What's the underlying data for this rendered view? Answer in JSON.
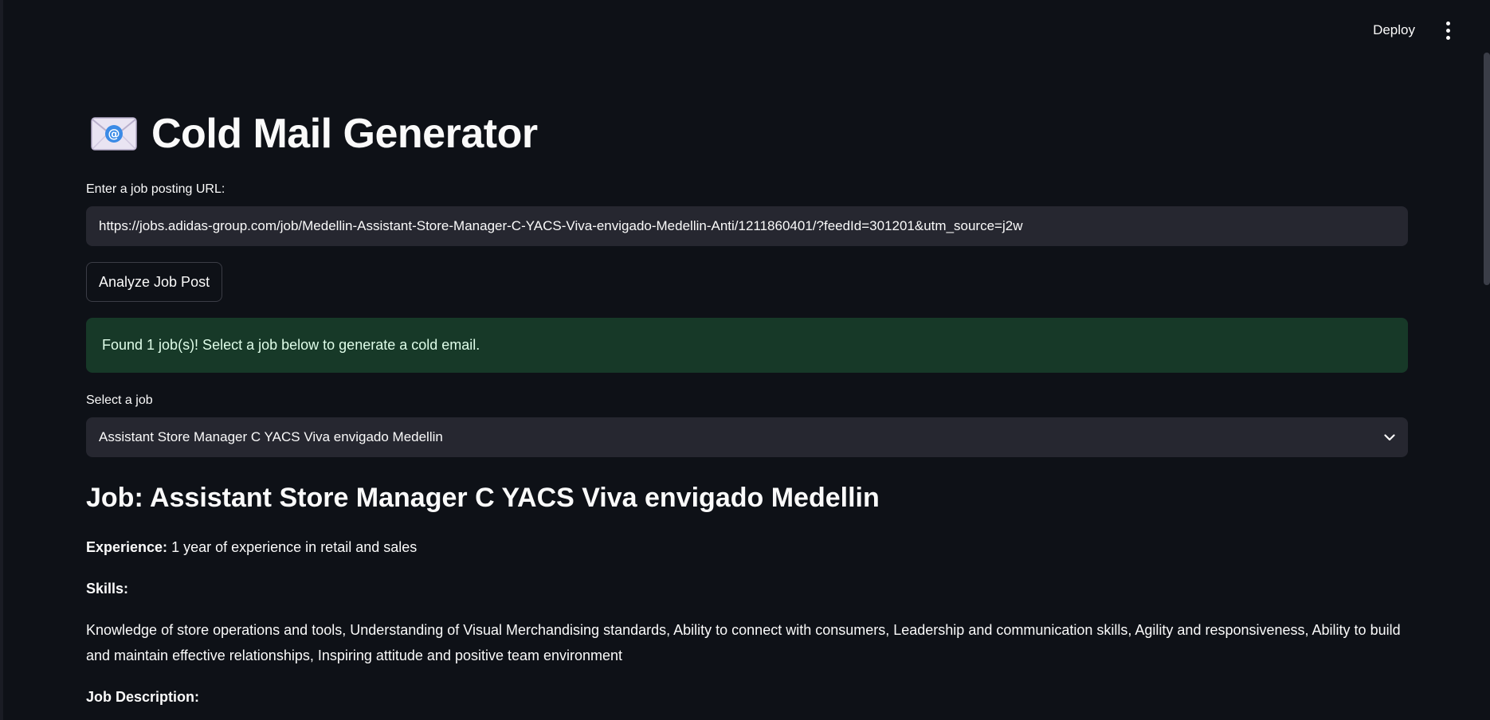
{
  "topbar": {
    "deploy_label": "Deploy",
    "menu_icon": "vertical-ellipsis-icon"
  },
  "header": {
    "icon": "envelope-icon",
    "title": "Cold Mail Generator"
  },
  "url_input": {
    "label": "Enter a job posting URL:",
    "value": "https://jobs.adidas-group.com/job/Medellin-Assistant-Store-Manager-C-YACS-Viva-envigado-Medellin-Anti/1211860401/?feedId=301201&utm_source=j2w"
  },
  "analyze_button": {
    "label": "Analyze Job Post"
  },
  "success_alert": {
    "text": "Found 1 job(s)! Select a job below to generate a cold email."
  },
  "job_select": {
    "label": "Select a job",
    "selected": "Assistant Store Manager C YACS Viva envigado Medellin"
  },
  "job_details": {
    "heading": "Job: Assistant Store Manager C YACS Viva envigado Medellin",
    "experience_label": "Experience:",
    "experience_value": "1 year of experience in retail and sales",
    "skills_label": "Skills:",
    "skills_value": "Knowledge of store operations and tools, Understanding of Visual Merchandising standards, Ability to connect with consumers, Leadership and communication skills, Agility and responsiveness, Ability to build and maintain effective relationships, Inspiring attitude and positive team environment",
    "description_label": "Job Description:"
  },
  "colors": {
    "background": "#0e1117",
    "input_bg": "#262730",
    "success_bg": "#173928",
    "success_text": "#dffde9",
    "text": "#fafafa"
  }
}
